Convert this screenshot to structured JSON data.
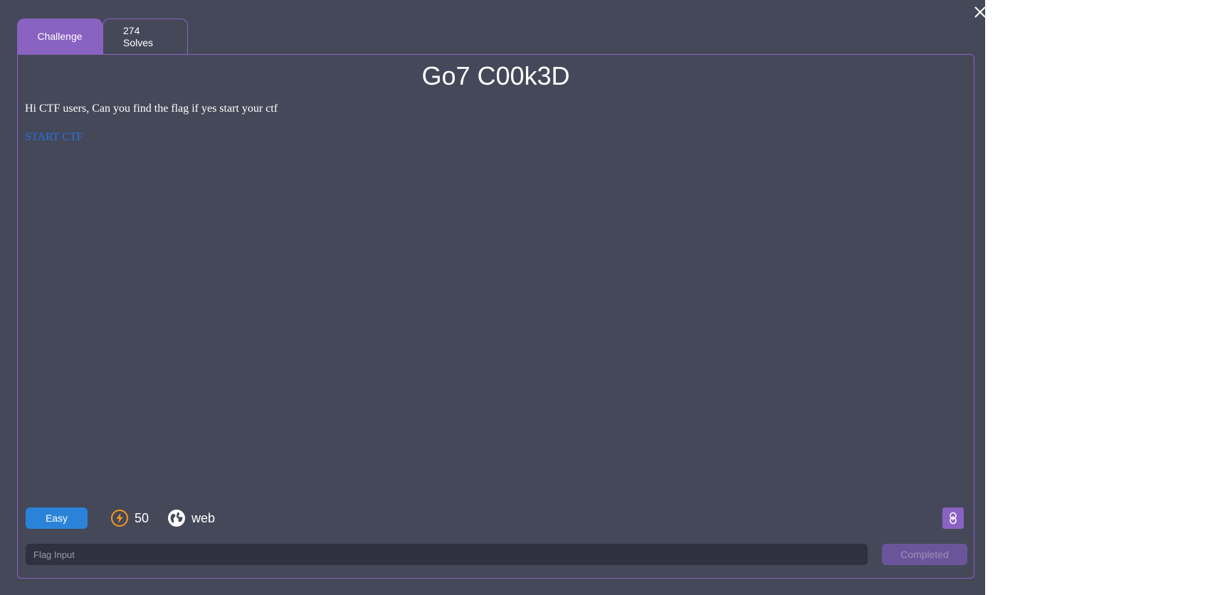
{
  "tabs": {
    "challenge_label": "Challenge",
    "solves_count": "274",
    "solves_label": "Solves"
  },
  "challenge": {
    "title": "Go7 C00k3D",
    "description": "Hi CTF users, Can you find the flag if yes start your ctf",
    "start_link": "START CTF",
    "difficulty": "Easy",
    "points": "50",
    "category": "web"
  },
  "form": {
    "flag_placeholder": "Flag Input",
    "flag_value": "",
    "submit_label": "Completed"
  },
  "icons": {
    "close": "close-icon",
    "points": "lightning-icon",
    "category": "globe-icon",
    "link": "link-icon"
  },
  "colors": {
    "background": "#454859",
    "accent": "#8a62c2",
    "easy_badge": "#2b83d9",
    "points_icon": "#f59a1c",
    "link_text": "#2b6fe0",
    "input_bg": "#2f3140"
  }
}
